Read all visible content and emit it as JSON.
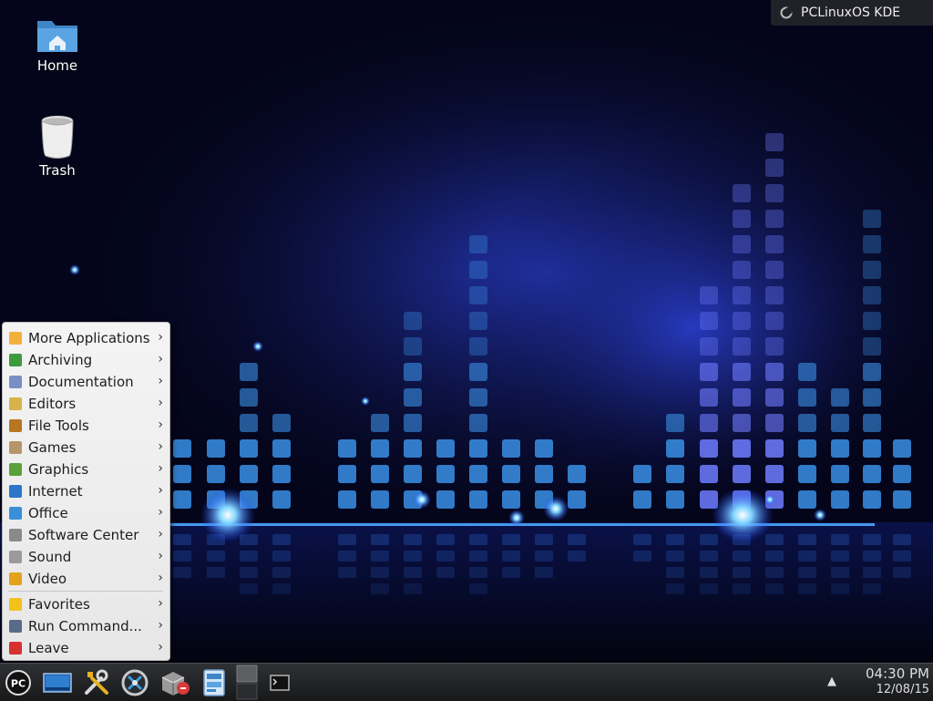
{
  "desktop": {
    "icons": [
      {
        "label": "Home",
        "icon": "folder-home-icon"
      },
      {
        "label": "Trash",
        "icon": "trash-icon"
      }
    ],
    "notice": "PCLinuxOS KDE"
  },
  "menu": {
    "items": [
      {
        "label": "More Applications",
        "icon": "more-applications-icon",
        "color": "#f2b13a"
      },
      {
        "label": "Archiving",
        "icon": "archiving-icon",
        "color": "#3c9b3e"
      },
      {
        "label": "Documentation",
        "icon": "documentation-icon",
        "color": "#7a8ec6"
      },
      {
        "label": "Editors",
        "icon": "editors-icon",
        "color": "#d8b24a"
      },
      {
        "label": "File Tools",
        "icon": "file-tools-icon",
        "color": "#b7761f"
      },
      {
        "label": "Games",
        "icon": "games-icon",
        "color": "#b7956a"
      },
      {
        "label": "Graphics",
        "icon": "graphics-icon",
        "color": "#5aa13a"
      },
      {
        "label": "Internet",
        "icon": "internet-icon",
        "color": "#2e74c9"
      },
      {
        "label": "Office",
        "icon": "office-icon",
        "color": "#3a8fd8"
      },
      {
        "label": "Software Center",
        "icon": "software-center-icon",
        "color": "#8a8a8a"
      },
      {
        "label": "Sound",
        "icon": "sound-icon",
        "color": "#9a9a9a"
      },
      {
        "label": "Video",
        "icon": "video-icon",
        "color": "#e3a21a"
      }
    ],
    "bottom_items": [
      {
        "label": "Favorites",
        "icon": "star-icon",
        "color": "#f2c21a"
      },
      {
        "label": "Run Command...",
        "icon": "gear-icon",
        "color": "#5a6b8a"
      },
      {
        "label": "Leave",
        "icon": "power-icon",
        "color": "#d63030"
      }
    ],
    "arrow": "›"
  },
  "taskbar": {
    "items": [
      {
        "icon": "pclinuxos-menu-icon"
      },
      {
        "icon": "show-desktop-icon"
      },
      {
        "icon": "system-tools-icon"
      },
      {
        "icon": "control-center-icon"
      },
      {
        "icon": "package-manager-icon"
      },
      {
        "icon": "file-manager-icon"
      },
      {
        "icon": "pager-icon"
      },
      {
        "icon": "terminal-icon"
      }
    ],
    "tray_arrow": "▲",
    "clock_time": "04:30 PM",
    "clock_date": "12/08/15"
  }
}
